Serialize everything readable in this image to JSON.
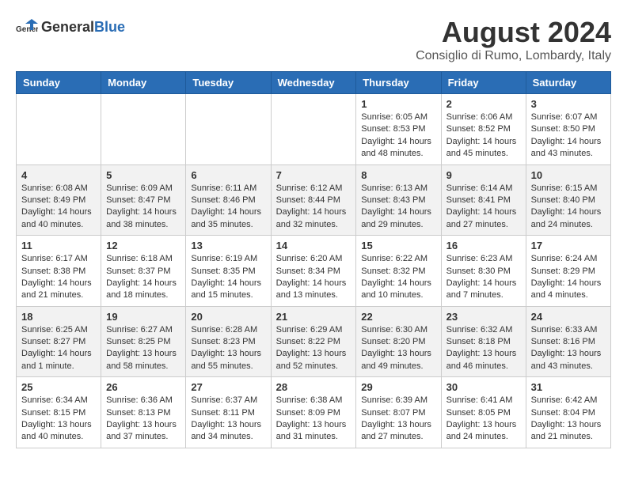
{
  "header": {
    "logo_general": "General",
    "logo_blue": "Blue",
    "month_title": "August 2024",
    "location": "Consiglio di Rumo, Lombardy, Italy"
  },
  "weekdays": [
    "Sunday",
    "Monday",
    "Tuesday",
    "Wednesday",
    "Thursday",
    "Friday",
    "Saturday"
  ],
  "weeks": [
    [
      {
        "day": "",
        "info": ""
      },
      {
        "day": "",
        "info": ""
      },
      {
        "day": "",
        "info": ""
      },
      {
        "day": "",
        "info": ""
      },
      {
        "day": "1",
        "info": "Sunrise: 6:05 AM\nSunset: 8:53 PM\nDaylight: 14 hours and 48 minutes."
      },
      {
        "day": "2",
        "info": "Sunrise: 6:06 AM\nSunset: 8:52 PM\nDaylight: 14 hours and 45 minutes."
      },
      {
        "day": "3",
        "info": "Sunrise: 6:07 AM\nSunset: 8:50 PM\nDaylight: 14 hours and 43 minutes."
      }
    ],
    [
      {
        "day": "4",
        "info": "Sunrise: 6:08 AM\nSunset: 8:49 PM\nDaylight: 14 hours and 40 minutes."
      },
      {
        "day": "5",
        "info": "Sunrise: 6:09 AM\nSunset: 8:47 PM\nDaylight: 14 hours and 38 minutes."
      },
      {
        "day": "6",
        "info": "Sunrise: 6:11 AM\nSunset: 8:46 PM\nDaylight: 14 hours and 35 minutes."
      },
      {
        "day": "7",
        "info": "Sunrise: 6:12 AM\nSunset: 8:44 PM\nDaylight: 14 hours and 32 minutes."
      },
      {
        "day": "8",
        "info": "Sunrise: 6:13 AM\nSunset: 8:43 PM\nDaylight: 14 hours and 29 minutes."
      },
      {
        "day": "9",
        "info": "Sunrise: 6:14 AM\nSunset: 8:41 PM\nDaylight: 14 hours and 27 minutes."
      },
      {
        "day": "10",
        "info": "Sunrise: 6:15 AM\nSunset: 8:40 PM\nDaylight: 14 hours and 24 minutes."
      }
    ],
    [
      {
        "day": "11",
        "info": "Sunrise: 6:17 AM\nSunset: 8:38 PM\nDaylight: 14 hours and 21 minutes."
      },
      {
        "day": "12",
        "info": "Sunrise: 6:18 AM\nSunset: 8:37 PM\nDaylight: 14 hours and 18 minutes."
      },
      {
        "day": "13",
        "info": "Sunrise: 6:19 AM\nSunset: 8:35 PM\nDaylight: 14 hours and 15 minutes."
      },
      {
        "day": "14",
        "info": "Sunrise: 6:20 AM\nSunset: 8:34 PM\nDaylight: 14 hours and 13 minutes."
      },
      {
        "day": "15",
        "info": "Sunrise: 6:22 AM\nSunset: 8:32 PM\nDaylight: 14 hours and 10 minutes."
      },
      {
        "day": "16",
        "info": "Sunrise: 6:23 AM\nSunset: 8:30 PM\nDaylight: 14 hours and 7 minutes."
      },
      {
        "day": "17",
        "info": "Sunrise: 6:24 AM\nSunset: 8:29 PM\nDaylight: 14 hours and 4 minutes."
      }
    ],
    [
      {
        "day": "18",
        "info": "Sunrise: 6:25 AM\nSunset: 8:27 PM\nDaylight: 14 hours and 1 minute."
      },
      {
        "day": "19",
        "info": "Sunrise: 6:27 AM\nSunset: 8:25 PM\nDaylight: 13 hours and 58 minutes."
      },
      {
        "day": "20",
        "info": "Sunrise: 6:28 AM\nSunset: 8:23 PM\nDaylight: 13 hours and 55 minutes."
      },
      {
        "day": "21",
        "info": "Sunrise: 6:29 AM\nSunset: 8:22 PM\nDaylight: 13 hours and 52 minutes."
      },
      {
        "day": "22",
        "info": "Sunrise: 6:30 AM\nSunset: 8:20 PM\nDaylight: 13 hours and 49 minutes."
      },
      {
        "day": "23",
        "info": "Sunrise: 6:32 AM\nSunset: 8:18 PM\nDaylight: 13 hours and 46 minutes."
      },
      {
        "day": "24",
        "info": "Sunrise: 6:33 AM\nSunset: 8:16 PM\nDaylight: 13 hours and 43 minutes."
      }
    ],
    [
      {
        "day": "25",
        "info": "Sunrise: 6:34 AM\nSunset: 8:15 PM\nDaylight: 13 hours and 40 minutes."
      },
      {
        "day": "26",
        "info": "Sunrise: 6:36 AM\nSunset: 8:13 PM\nDaylight: 13 hours and 37 minutes."
      },
      {
        "day": "27",
        "info": "Sunrise: 6:37 AM\nSunset: 8:11 PM\nDaylight: 13 hours and 34 minutes."
      },
      {
        "day": "28",
        "info": "Sunrise: 6:38 AM\nSunset: 8:09 PM\nDaylight: 13 hours and 31 minutes."
      },
      {
        "day": "29",
        "info": "Sunrise: 6:39 AM\nSunset: 8:07 PM\nDaylight: 13 hours and 27 minutes."
      },
      {
        "day": "30",
        "info": "Sunrise: 6:41 AM\nSunset: 8:05 PM\nDaylight: 13 hours and 24 minutes."
      },
      {
        "day": "31",
        "info": "Sunrise: 6:42 AM\nSunset: 8:04 PM\nDaylight: 13 hours and 21 minutes."
      }
    ]
  ]
}
